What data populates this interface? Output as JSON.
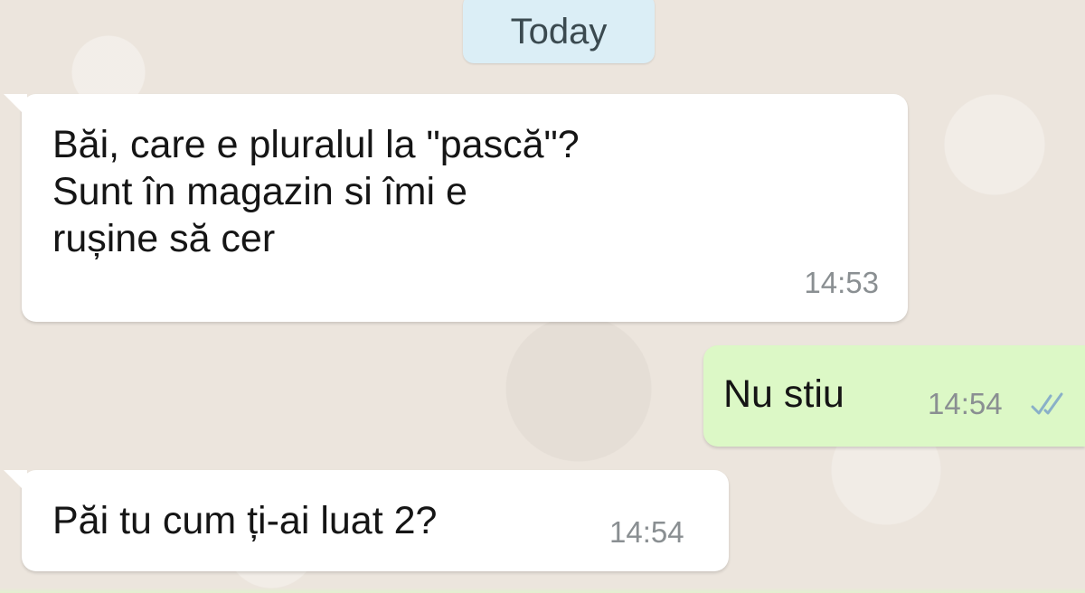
{
  "day_separator": "Today",
  "messages": [
    {
      "direction": "incoming",
      "lines": [
        "Băi, care e pluralul la \"pască\"?",
        "Sunt în magazin si îmi e",
        "rușine să cer"
      ],
      "time": "14:53"
    },
    {
      "direction": "outgoing",
      "text": "Nu stiu",
      "time": "14:54",
      "status_icon": "double-check-icon"
    },
    {
      "direction": "incoming",
      "text": "Păi tu cum ți-ai luat 2?",
      "time": "14:54"
    }
  ],
  "colors": {
    "background": "#ece5dd",
    "incoming_bubble": "#ffffff",
    "outgoing_bubble": "#dcf8c6",
    "day_chip": "#dbeef6",
    "timestamp": "#8a8f92",
    "read_ticks": "#8ab0c8"
  }
}
